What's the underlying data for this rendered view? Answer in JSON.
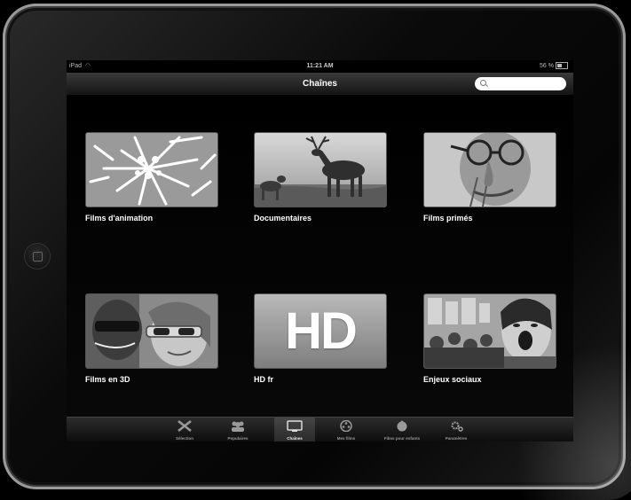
{
  "status_bar": {
    "device": "iPad",
    "time": "11:21 AM",
    "battery": "56 %"
  },
  "nav": {
    "title": "Chaînes",
    "search_placeholder": ""
  },
  "channels": [
    {
      "label": "Films d'animation",
      "icon": "animation-thumbnail"
    },
    {
      "label": "Documentaires",
      "icon": "documentary-thumbnail"
    },
    {
      "label": "Films primés",
      "icon": "award-thumbnail"
    },
    {
      "label": "Films en 3D",
      "icon": "3d-thumbnail"
    },
    {
      "label": "HD fr",
      "icon": "hd-thumbnail",
      "thumb_text": "HD"
    },
    {
      "label": "Enjeux sociaux",
      "icon": "social-thumbnail"
    }
  ],
  "tabbar": {
    "active_index": 2,
    "tabs": [
      {
        "label": "Sélection",
        "icon": "tools-icon"
      },
      {
        "label": "Populaires",
        "icon": "people-icon"
      },
      {
        "label": "Chaînes",
        "icon": "tv-icon"
      },
      {
        "label": "Mes films",
        "icon": "film-reel-icon"
      },
      {
        "label": "Films pour enfants",
        "icon": "kids-icon"
      },
      {
        "label": "Paramètres",
        "icon": "gear-icon"
      }
    ]
  }
}
